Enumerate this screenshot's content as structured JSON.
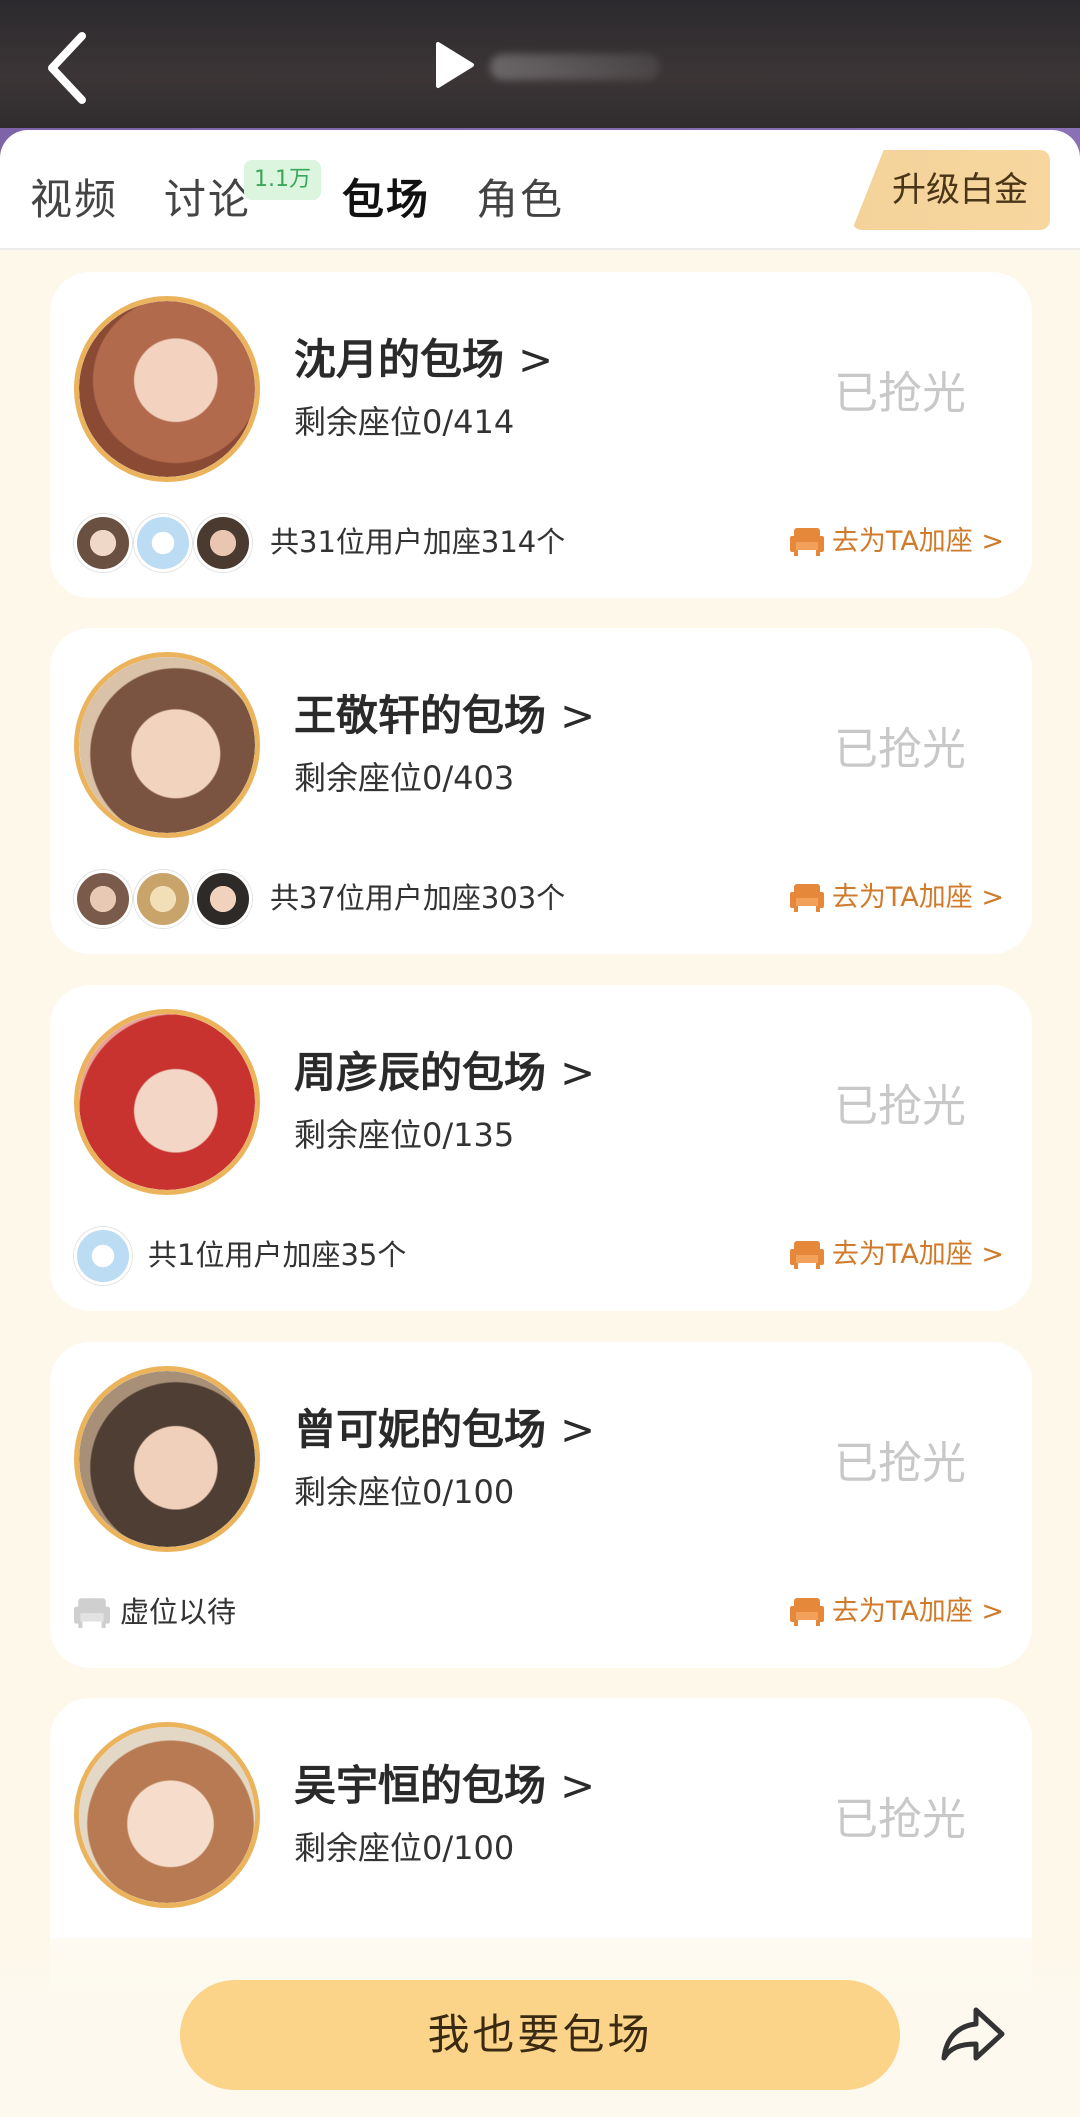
{
  "tabs": [
    {
      "label": "视频",
      "active": false
    },
    {
      "label": "讨论",
      "active": false,
      "badge": "1.1万"
    },
    {
      "label": "包场",
      "active": true
    },
    {
      "label": "角色",
      "active": false
    }
  ],
  "upgrade_label": "升级白金",
  "cards": [
    {
      "title": "沈月的包场",
      "chevron": ">",
      "seats": "剩余座位0/414",
      "status": "已抢光",
      "users_text": "共31位用户加座314个",
      "add_label": "去为TA加座 >",
      "avatar_color": "#c8795f"
    },
    {
      "title": "王敬轩的包场",
      "chevron": ">",
      "seats": "剩余座位0/403",
      "status": "已抢光",
      "users_text": "共37位用户加座303个",
      "add_label": "去为TA加座 >",
      "avatar_color": "#7a5440"
    },
    {
      "title": "周彦辰的包场",
      "chevron": ">",
      "seats": "剩余座位0/135",
      "status": "已抢光",
      "users_text": "共1位用户加座35个",
      "add_label": "去为TA加座 >",
      "avatar_color": "#d23a3a"
    },
    {
      "title": "曾可妮的包场",
      "chevron": ">",
      "seats": "剩余座位0/100",
      "status": "已抢光",
      "users_text": "虚位以待",
      "add_label": "去为TA加座 >",
      "avatar_color": "#6b5646"
    },
    {
      "title": "吴宇恒的包场",
      "chevron": ">",
      "seats": "剩余座位0/100",
      "status": "已抢光",
      "users_text": "",
      "add_label": "",
      "avatar_color": "#c98658"
    }
  ],
  "bottom_button": "我也要包场",
  "icons": {
    "back": "back-chevron-icon",
    "play": "play-icon",
    "sofa": "sofa-icon",
    "share": "share-arrow-icon"
  },
  "colors": {
    "accent": "#d07a2b",
    "gold_ring": "#eab35c",
    "button_bg": "#fbd48a",
    "badge_bg": "#dbf5de",
    "page_bg": "#fdf8e9"
  }
}
